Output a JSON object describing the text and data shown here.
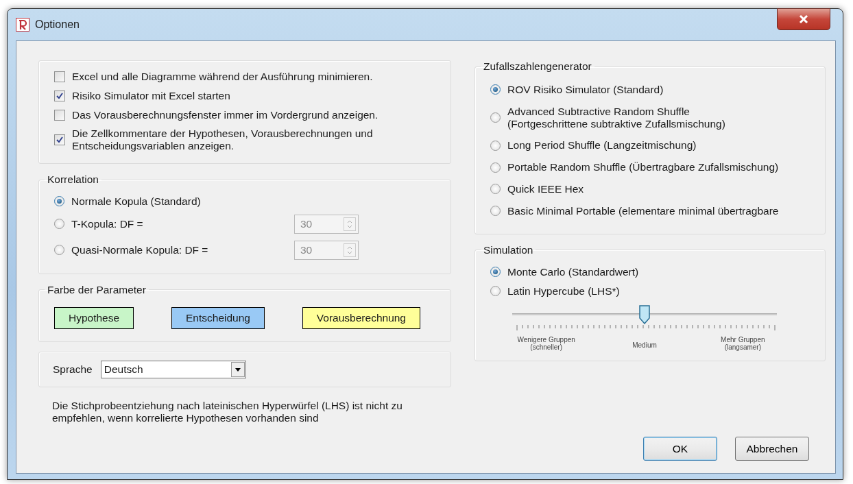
{
  "window": {
    "title": "Optionen"
  },
  "general": {
    "options": [
      {
        "label": "Excel und alle Diagramme während der Ausführung minimieren.",
        "checked": false
      },
      {
        "label": "Risiko Simulator mit Excel starten",
        "checked": true
      },
      {
        "label": "Das Vorausberechnungsfenster immer im Vordergrund anzeigen.",
        "checked": false
      },
      {
        "label": "Die Zellkommentare der Hypothesen, Vorausberechnungen und Entscheidungsvariablen anzeigen.",
        "checked": true
      }
    ]
  },
  "correlation": {
    "title": "Korrelation",
    "options": [
      {
        "label": "Normale Kopula (Standard)",
        "selected": true
      },
      {
        "label": "T-Kopula: DF =",
        "selected": false,
        "spin": {
          "value": "30",
          "disabled": true
        }
      },
      {
        "label": "Quasi-Normale Kopula: DF =",
        "selected": false,
        "spin": {
          "value": "30",
          "disabled": true
        }
      }
    ]
  },
  "parameter_colors": {
    "title": "Farbe der Parameter",
    "buttons": [
      {
        "label": "Hypothese",
        "color": "#c8f5c8"
      },
      {
        "label": "Entscheidung",
        "color": "#99c9f5"
      },
      {
        "label": "Vorausberechnung",
        "color": "#ffff99"
      }
    ]
  },
  "language": {
    "label": "Sprache",
    "value": "Deutsch"
  },
  "note": "Die Stichprobeentziehung nach lateinischen Hyperwürfel (LHS) ist nicht zu empfehlen, wenn korrelierte Hypothesen vorhanden sind",
  "rng": {
    "title": "Zufallszahlengenerator",
    "options": [
      {
        "label": "ROV Risiko Simulator (Standard)",
        "selected": true
      },
      {
        "label": "Advanced Subtractive Random Shuffle\n(Fortgeschrittene subtraktive Zufallsmischung)",
        "selected": false
      },
      {
        "label": "Long Period Shuffle (Langzeitmischung)",
        "selected": false
      },
      {
        "label": "Portable Random Shuffle (Übertragbare Zufallsmischung)",
        "selected": false
      },
      {
        "label": "Quick IEEE Hex",
        "selected": false
      },
      {
        "label": "Basic Minimal Portable (elementare minimal übertragbare",
        "selected": false
      }
    ]
  },
  "simulation": {
    "title": "Simulation",
    "options": [
      {
        "label": "Monte Carlo (Standardwert)",
        "selected": true
      },
      {
        "label": "Latin Hypercube (LHS*)",
        "selected": false
      }
    ],
    "slider": {
      "level": 0.5,
      "labels": [
        "Wenigere Gruppen\n(schneller)",
        "Medium",
        "Mehr Gruppen\n(langsamer)"
      ]
    }
  },
  "buttons": [
    {
      "label": "OK",
      "default": true
    },
    {
      "label": "Abbrechen",
      "default": false
    }
  ]
}
